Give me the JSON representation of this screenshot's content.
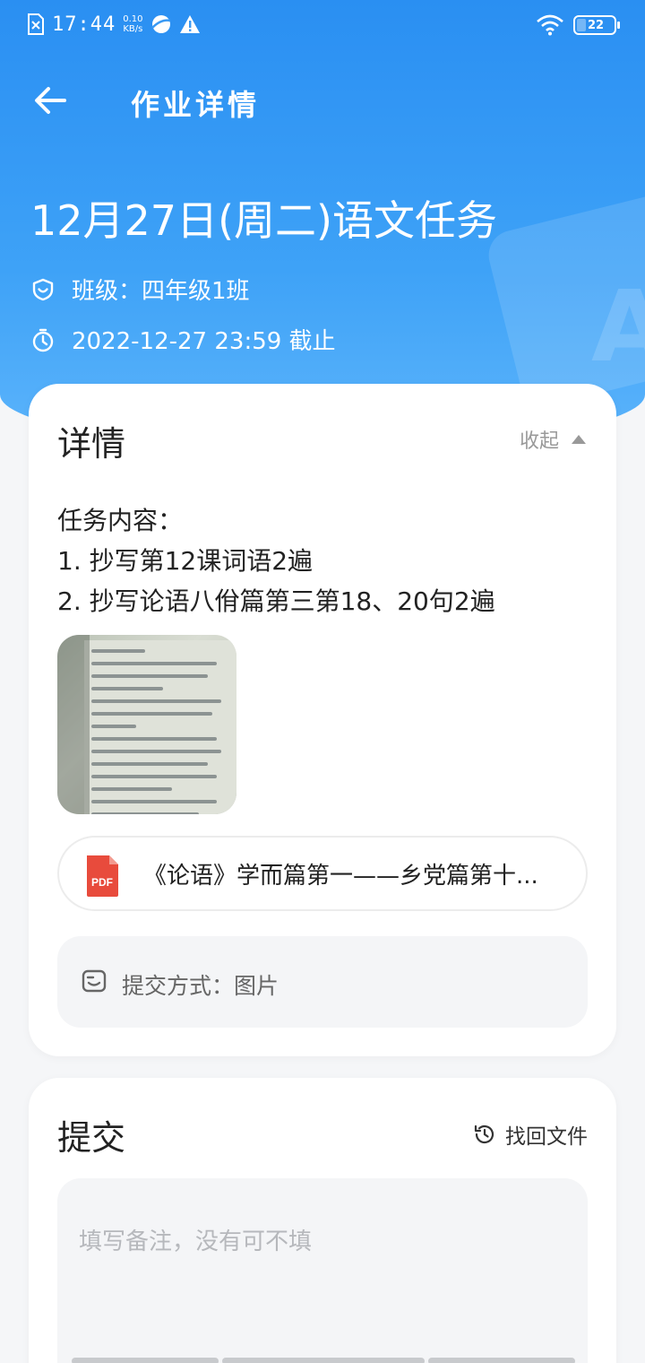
{
  "status_bar": {
    "time": "17:44",
    "net_speed_value": "0.10",
    "net_speed_unit": "KB/s",
    "battery": "22",
    "icons": [
      "sim-icon",
      "browser-icon",
      "warning-icon",
      "wifi-icon",
      "battery-icon"
    ]
  },
  "header": {
    "title": "作业详情"
  },
  "task": {
    "title": "12月27日(周二)语文任务",
    "class_label": "班级：四年级1班",
    "deadline": "2022-12-27 23:59 截止"
  },
  "detail_card": {
    "heading": "详情",
    "collapse_label": "收起",
    "content_lines": [
      "任务内容：",
      "1. 抄写第12课词语2遍",
      "2. 抄写论语八佾篇第三第18、20句2遍"
    ],
    "attachment_file": {
      "type_label": "PDF",
      "name": "《论语》学而篇第一——乡党篇第十..."
    },
    "submit_method": "提交方式：图片"
  },
  "submit_card": {
    "heading": "提交",
    "recover_label": "找回文件",
    "note_placeholder": "填写备注，没有可不填"
  },
  "colors": {
    "header_blue": "#2a8ff2",
    "pdf_red": "#e84b3c"
  }
}
